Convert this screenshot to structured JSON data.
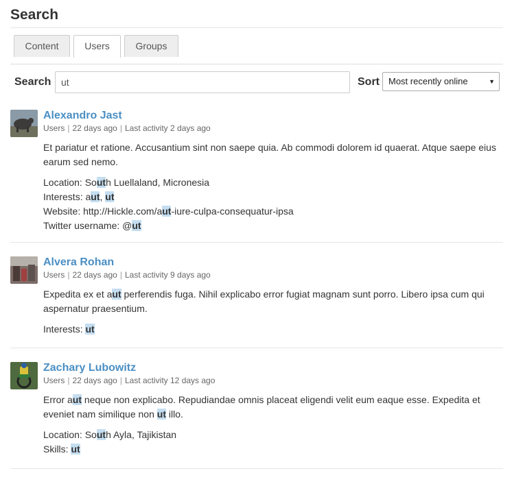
{
  "header": {
    "title": "Search"
  },
  "tabs": [
    {
      "label": "Content",
      "active": false
    },
    {
      "label": "Users",
      "active": true
    },
    {
      "label": "Groups",
      "active": false
    }
  ],
  "search": {
    "label": "Search",
    "value": "ut",
    "sort_label": "Sort",
    "sort_selected": "Most recently online"
  },
  "highlight_color": "#c4def1",
  "link_color": "#4a8fc4",
  "results": [
    {
      "name": "Alexandro Jast",
      "meta": [
        "Users",
        "22 days ago",
        "Last activity 2 days ago"
      ],
      "bio": "Et pariatur et ratione. Accusantium sint non saepe quia. Ab commodi dolorem id quaerat. Atque saepe eius earum sed nemo.",
      "fields": [
        "Location: So[ut]h Luellaland, Micronesia",
        "Interests: a[ut], [ut]",
        "Website: http://Hickle.com/a[ut]-iure-culpa-consequatur-ipsa",
        "Twitter username: @[ut]"
      ]
    },
    {
      "name": "Alvera Rohan",
      "meta": [
        "Users",
        "22 days ago",
        "Last activity 9 days ago"
      ],
      "bio": "Expedita ex et a[ut] perferendis fuga. Nihil explicabo error fugiat magnam sunt porro. Libero ipsa cum qui aspernatur praesentium.",
      "fields": [
        "Interests: [ut]"
      ]
    },
    {
      "name": "Zachary Lubowitz",
      "meta": [
        "Users",
        "22 days ago",
        "Last activity 12 days ago"
      ],
      "bio": "Error a[ut] neque non explicabo. Repudiandae omnis placeat eligendi velit eum eaque esse. Expedita et eveniet nam similique non [ut] illo.",
      "fields": [
        "Location: So[ut]h Ayla, Tajikistan",
        "Skills: [ut]"
      ]
    }
  ]
}
